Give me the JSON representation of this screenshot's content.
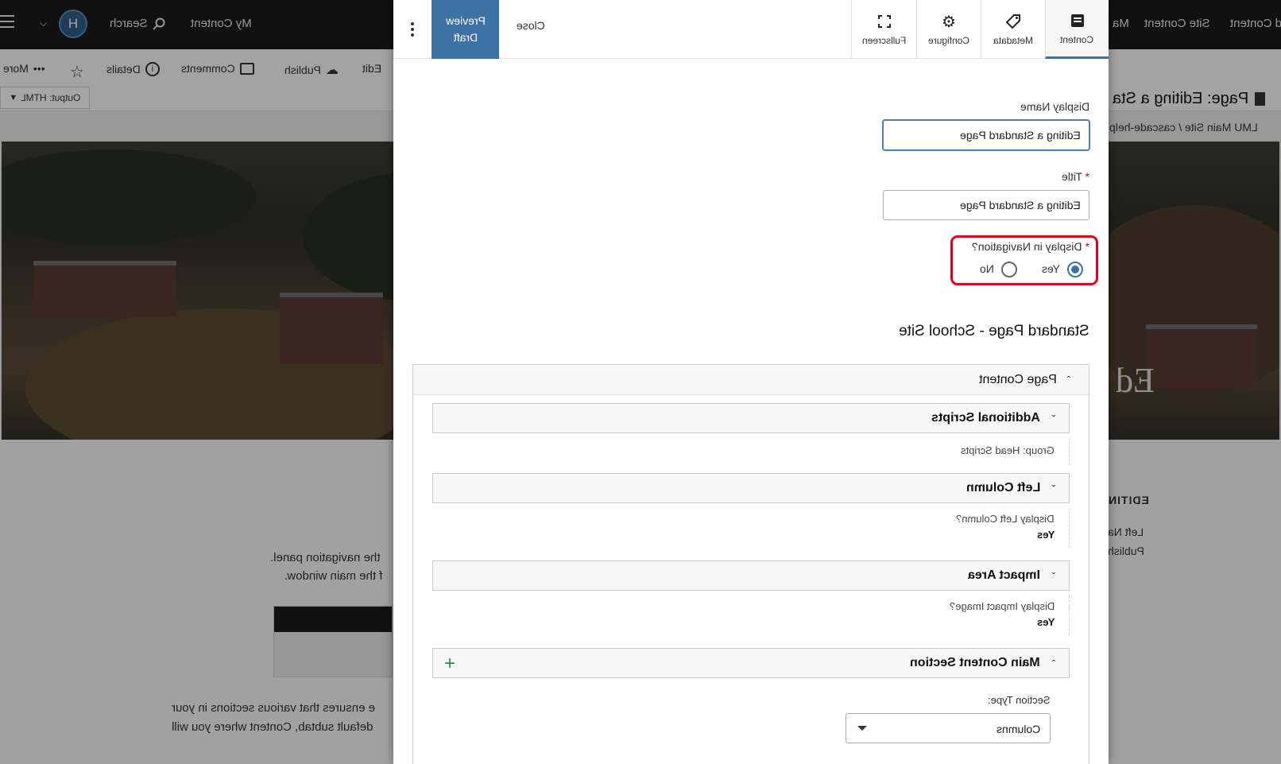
{
  "background": {
    "topbar": {
      "nav_items": [
        "d Content",
        "Site Content",
        "Ma"
      ],
      "my_content": "My Content",
      "search": "Search",
      "avatar_letter": "H"
    },
    "toolbar": {
      "edit": "Edit",
      "publish": "Publish",
      "comments": "Comments",
      "details": "Details",
      "more": "More",
      "output": "Output: HTML"
    },
    "page_title": "Page: Editing a Sta",
    "breadcrumb": "LMU Main Site / cascade-help",
    "hero_text": "Ed",
    "side_heading": "EDITIN",
    "side_lines": [
      "Left Na",
      "Publish"
    ],
    "body_lines": [
      "the navigation panel.",
      "f the main window.",
      "e ensures that various sections in your",
      "default subtab, Content where you will"
    ]
  },
  "modal": {
    "header": {
      "preview_draft": "Preview Draft",
      "close": "Close",
      "tabs": [
        {
          "label": "Fullscreen",
          "icon": "fullscreen-icon"
        },
        {
          "label": "Configure",
          "icon": "gear-icon"
        },
        {
          "label": "Metadata",
          "icon": "tag-icon"
        },
        {
          "label": "Content",
          "icon": "document-icon"
        }
      ]
    },
    "display_name": {
      "label": "Display Name",
      "value": "Editing a Standard Page"
    },
    "title": {
      "label": "Title",
      "required": "*",
      "value": "Editing a Standard Page"
    },
    "display_in_nav": {
      "label": "Display in Navigation?",
      "required": "*",
      "yes": "Yes",
      "no": "No",
      "selected": "Yes"
    },
    "section_title": "Standard Page - School Site",
    "page_content": {
      "title": "Page Content",
      "groups": [
        {
          "title": "Additional Scripts",
          "label": "Group: Head Scripts",
          "value": ""
        },
        {
          "title": "Left Column",
          "label": "Display Left Column?",
          "value": "Yes"
        },
        {
          "title": "Impact Area",
          "label": "Display Impact Image?",
          "value": "Yes"
        }
      ],
      "main_content": {
        "title": "Main Content Section",
        "add": "+",
        "section_type_label": "Section Type:",
        "section_type_value": "Columns"
      }
    }
  },
  "colors": {
    "accent": "#3d72a4",
    "highlight": "#e0001b",
    "add": "#2e8b57"
  }
}
